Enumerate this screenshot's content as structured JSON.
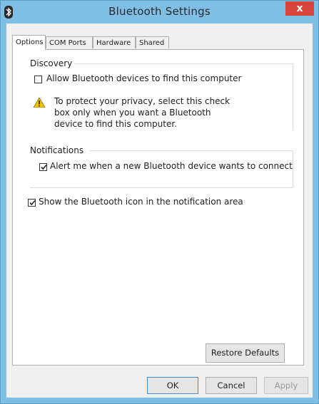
{
  "window": {
    "title": "Bluetooth Settings",
    "close_glyph": "x"
  },
  "tabs": [
    {
      "label": "Options",
      "active": true
    },
    {
      "label": "COM Ports",
      "active": false
    },
    {
      "label": "Hardware",
      "active": false
    },
    {
      "label": "Shared",
      "active": false
    }
  ],
  "discovery": {
    "heading": "Discovery",
    "allow_label": "Allow Bluetooth devices to find this computer",
    "allow_checked": false,
    "note": "To protect your privacy, select this check box only when you want a Bluetooth device to find this computer.",
    "note_icon": "warning-icon"
  },
  "notifications": {
    "heading": "Notifications",
    "alert_label": "Alert me when a new Bluetooth device wants to connect",
    "alert_checked": true
  },
  "show_icon": {
    "label": "Show the Bluetooth icon in the notification area",
    "checked": true
  },
  "buttons": {
    "restore": "Restore Defaults",
    "ok": "OK",
    "cancel": "Cancel",
    "apply": "Apply"
  },
  "colors": {
    "frame": "#7fbfe6",
    "close": "#d9453b",
    "warning": "#f2c200"
  }
}
